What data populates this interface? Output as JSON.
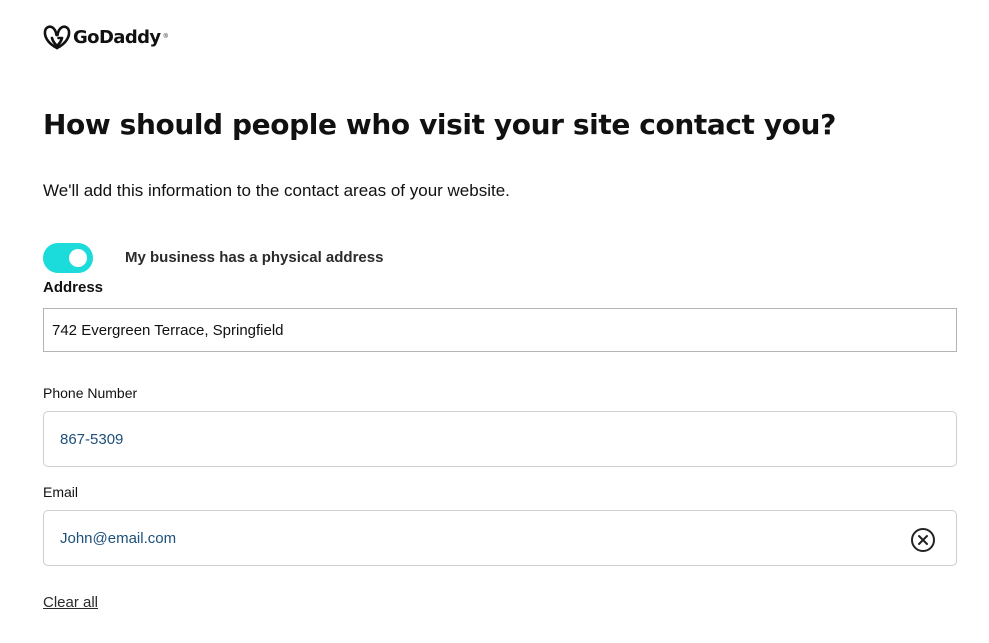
{
  "brand": {
    "logo_text": "GoDaddy",
    "logo_tm": "®",
    "logo_icon": "godaddy-heart-icon"
  },
  "page": {
    "title": "How should people who visit your site contact you?",
    "subtitle": "We'll add this information to the contact areas of your website."
  },
  "physical_address_toggle": {
    "label": "My business has a physical address",
    "checked": true,
    "on_color": "#1bdbdb"
  },
  "address": {
    "label": "Address",
    "value": "742 Evergreen Terrace, Springfield"
  },
  "phone": {
    "label": "Phone Number",
    "value": "867-5309"
  },
  "email": {
    "label": "Email",
    "value": "John@email.com",
    "clear_icon": "circle-x-icon"
  },
  "actions": {
    "clear_all_label": "Clear all"
  },
  "colors": {
    "input_value": "#1d4f7a",
    "accent": "#1bdbdb"
  }
}
